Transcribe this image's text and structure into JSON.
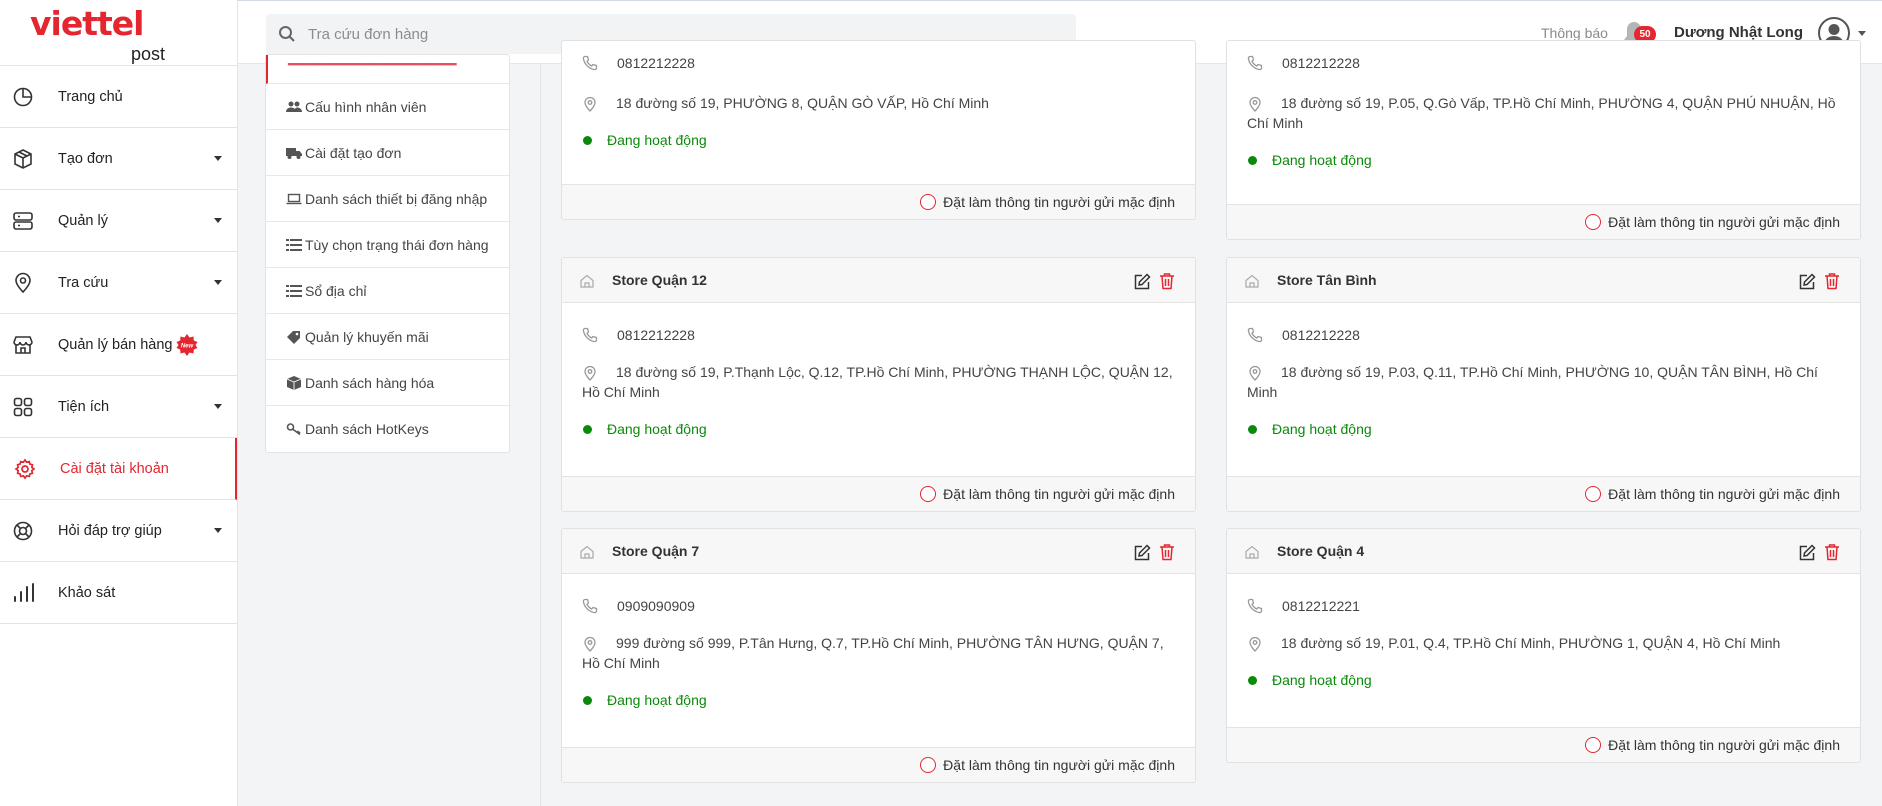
{
  "brand": {
    "name": "viettel",
    "sub": "post",
    "accent": "#e3262f"
  },
  "sidebar": {
    "items": [
      {
        "label": "Trang chủ",
        "icon": "clock-pie-icon",
        "caret": false
      },
      {
        "label": "Tạo đơn",
        "icon": "box-icon",
        "caret": true
      },
      {
        "label": "Quản lý",
        "icon": "server-icon",
        "caret": true
      },
      {
        "label": "Tra cứu",
        "icon": "map-pin-icon",
        "caret": true
      },
      {
        "label": "Quản lý bán hàng",
        "icon": "store-icon",
        "caret": false,
        "badge": "New"
      },
      {
        "label": "Tiện ích",
        "icon": "grid-icon",
        "caret": true
      },
      {
        "label": "Cài đặt tài khoản",
        "icon": "gear-icon",
        "caret": false,
        "active": true
      },
      {
        "label": "Hỏi đáp trợ giúp",
        "icon": "lifebuoy-icon",
        "caret": true
      },
      {
        "label": "Khảo sát",
        "icon": "bar-chart-icon",
        "caret": false
      }
    ]
  },
  "header": {
    "search_placeholder": "Tra cứu đơn hàng",
    "notif_label": "Thông báo",
    "notif_count": "50",
    "user_name": "Dương Nhật Long"
  },
  "submenu": {
    "items": [
      {
        "label": "Cấu hình nhân viên",
        "icon": "users-icon"
      },
      {
        "label": "Cài đặt tạo đơn",
        "icon": "truck-icon"
      },
      {
        "label": "Danh sách thiết bị đăng nhập",
        "icon": "laptop-icon"
      },
      {
        "label": "Tùy chọn trạng thái đơn hàng",
        "icon": "list-icon"
      },
      {
        "label": "Sổ địa chỉ",
        "icon": "list-icon"
      },
      {
        "label": "Quản lý khuyến mãi",
        "icon": "tag-icon"
      },
      {
        "label": "Danh sách hàng hóa",
        "icon": "cube-icon"
      },
      {
        "label": "Danh sách HotKeys",
        "icon": "key-icon"
      }
    ]
  },
  "stores": {
    "default_label": "Đặt làm thông tin người gửi mặc định",
    "status_label": "Đang hoạt động",
    "top_left": {
      "phone": "0812212228",
      "address": "18 đường số 19, PHƯỜNG 8, QUẬN GÒ VẤP, Hồ Chí Minh"
    },
    "top_right": {
      "phone": "0812212228",
      "address": "18 đường số 19, P.05, Q.Gò Vấp, TP.Hồ Chí Minh, PHƯỜNG 4, QUẬN PHÚ NHUẬN, Hồ Chí Minh"
    },
    "q12": {
      "name": "Store Quận 12",
      "phone": "0812212228",
      "address": "18 đường số 19, P.Thạnh Lộc, Q.12, TP.Hồ Chí Minh, PHƯỜNG THẠNH LỘC, QUẬN 12, Hồ Chí Minh"
    },
    "tanbinh": {
      "name": "Store Tân Bình",
      "phone": "0812212228",
      "address": "18 đường số 19, P.03, Q.11, TP.Hồ Chí Minh, PHƯỜNG 10, QUẬN TÂN BÌNH, Hồ Chí Minh"
    },
    "q7": {
      "name": "Store Quận 7",
      "phone": "0909090909",
      "address": "999 đường số 999, P.Tân Hưng, Q.7, TP.Hồ Chí Minh, PHƯỜNG TÂN HƯNG, QUẬN 7, Hồ Chí Minh"
    },
    "q4": {
      "name": "Store Quận 4",
      "phone": "0812212221",
      "address": "18 đường số 19, P.01, Q.4, TP.Hồ Chí Minh, PHƯỜNG 1, QUẬN 4, Hồ Chí Minh"
    }
  }
}
